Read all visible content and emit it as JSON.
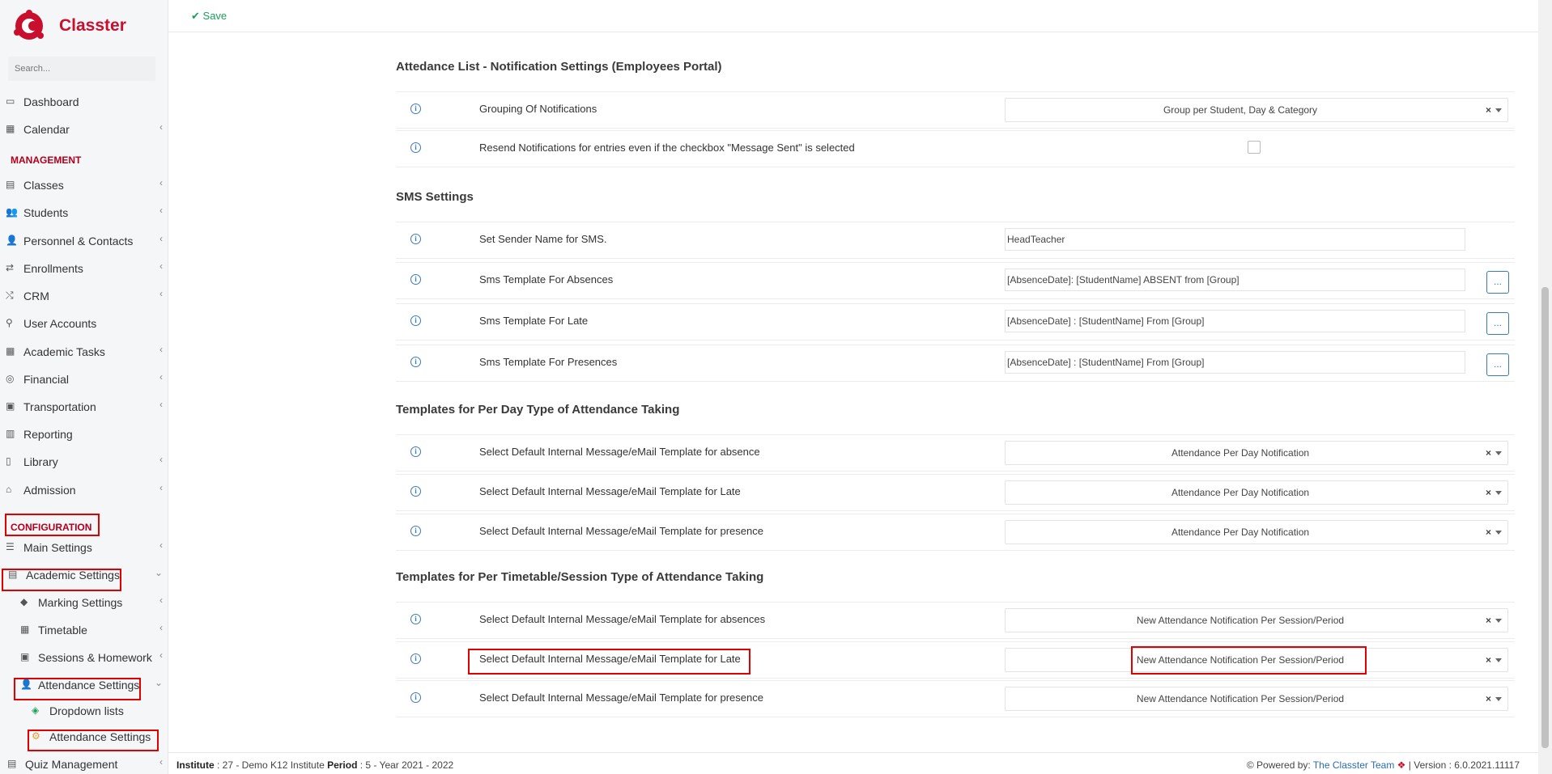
{
  "app": {
    "brand": "Classter",
    "search_placeholder": "Search..."
  },
  "sidebar": {
    "items": [
      {
        "label": "Dashboard",
        "icon": "monitor-icon"
      },
      {
        "label": "Calendar",
        "icon": "calendar-icon",
        "chevron": "‹"
      },
      {
        "label": "Classes",
        "icon": "classes-icon",
        "chevron": "‹"
      },
      {
        "label": "Students",
        "icon": "students-icon",
        "chevron": "‹"
      },
      {
        "label": "Personnel & Contacts",
        "icon": "personnel-icon",
        "chevron": "‹"
      },
      {
        "label": "Enrollments",
        "icon": "enrollments-icon",
        "chevron": "‹"
      },
      {
        "label": "CRM",
        "icon": "crm-icon",
        "chevron": "‹"
      },
      {
        "label": "User Accounts",
        "icon": "key-icon"
      },
      {
        "label": "Academic Tasks",
        "icon": "tasks-icon",
        "chevron": "‹"
      },
      {
        "label": "Financial",
        "icon": "coins-icon",
        "chevron": "‹"
      },
      {
        "label": "Transportation",
        "icon": "bus-icon",
        "chevron": "‹"
      },
      {
        "label": "Reporting",
        "icon": "print-icon"
      },
      {
        "label": "Library",
        "icon": "library-icon",
        "chevron": "‹"
      },
      {
        "label": "Admission",
        "icon": "bank-icon",
        "chevron": "‹"
      },
      {
        "label": "Main Settings",
        "icon": "sliders-icon",
        "chevron": "‹"
      },
      {
        "label": "Academic Settings",
        "icon": "academic-icon",
        "chevron": "⌄"
      },
      {
        "label": "Marking Settings",
        "icon": "grad-cap-icon",
        "chevron": "‹"
      },
      {
        "label": "Timetable",
        "icon": "timetable-icon",
        "chevron": "‹"
      },
      {
        "label": "Sessions & Homework",
        "icon": "sessions-icon",
        "chevron": "‹"
      },
      {
        "label": "Attendance Settings",
        "icon": "user-check-icon",
        "chevron": "⌄"
      },
      {
        "label": "Dropdown lists",
        "icon": "layers-icon"
      },
      {
        "label": "Attendance Settings",
        "icon": "gear-icon"
      },
      {
        "label": "Quiz Management",
        "icon": "quiz-icon",
        "chevron": "‹"
      }
    ],
    "sections": {
      "management": "MANAGEMENT",
      "configuration": "CONFIGURATION"
    }
  },
  "toolbar": {
    "save_label": "Save"
  },
  "sections": [
    {
      "title": "Attedance List - Notification Settings (Employees Portal)",
      "rows": [
        {
          "label": "Grouping Of Notifications",
          "kind": "select",
          "value": "Group per Student, Day & Category"
        },
        {
          "label": "Resend Notifications for entries even if the checkbox \"Message Sent\" is selected",
          "kind": "checkbox",
          "checked": false
        }
      ]
    },
    {
      "title": "SMS Settings",
      "rows": [
        {
          "label": "Set Sender Name for SMS.",
          "kind": "text",
          "value": "HeadTeacher"
        },
        {
          "label": "Sms Template For Absences",
          "kind": "text-dots",
          "value": "[AbsenceDate]: [StudentName] ABSENT from [Group]",
          "button": "..."
        },
        {
          "label": "Sms Template For Late",
          "kind": "text-dots",
          "value": "[AbsenceDate] : [StudentName] From [Group]",
          "button": "..."
        },
        {
          "label": "Sms Template For Presences",
          "kind": "text-dots",
          "value": "[AbsenceDate] : [StudentName] From [Group]",
          "button": "..."
        }
      ]
    },
    {
      "title": "Templates for Per Day Type of Attendance Taking",
      "rows": [
        {
          "label": "Select Default Internal Message/eMail Template for absence",
          "kind": "select",
          "value": "Attendance Per Day Notification"
        },
        {
          "label": "Select Default Internal Message/eMail Template for Late",
          "kind": "select",
          "value": "Attendance Per Day Notification"
        },
        {
          "label": "Select Default Internal Message/eMail Template for presence",
          "kind": "select",
          "value": "Attendance Per Day Notification"
        }
      ]
    },
    {
      "title": "Templates for Per Timetable/Session Type of Attendance Taking",
      "rows": [
        {
          "label": "Select Default Internal Message/eMail Template for absences",
          "kind": "select",
          "value": "New Attendance Notification Per Session/Period"
        },
        {
          "label": "Select Default Internal Message/eMail Template for Late",
          "kind": "select",
          "value": "New Attendance Notification Per Session/Period"
        },
        {
          "label": "Select Default Internal Message/eMail Template for presence",
          "kind": "select",
          "value": "New Attendance Notification Per Session/Period"
        }
      ]
    }
  ],
  "select_clear": "×",
  "info_glyph": "i",
  "footer": {
    "institute_label": "Institute",
    "institute_value": " : 27 - Demo K12 Institute ",
    "period_label": "Period",
    "period_value": " : 5 - Year 2021 - 2022",
    "powered_label": "Powered by: ",
    "powered_link": "The Classter Team",
    "version": " | Version : 6.0.2021.11117"
  },
  "colors": {
    "brand": "#c8102e",
    "save": "#1a9e5a",
    "highlight": "#e00000",
    "link": "#2a6db0"
  }
}
